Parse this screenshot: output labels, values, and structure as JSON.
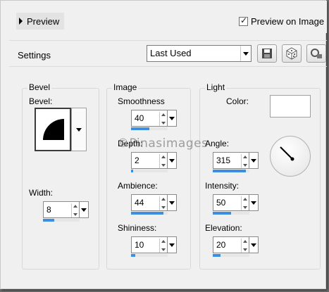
{
  "preview": {
    "toggle_label": "Preview",
    "checkbox_label": "Preview on Image",
    "checked": true
  },
  "settings": {
    "label": "Settings",
    "preset_value": "Last Used",
    "icons": [
      "save-icon",
      "dice-icon",
      "reset-icon"
    ]
  },
  "bevel_group": {
    "title": "Bevel",
    "bevel_label": "Bevel:",
    "width_label": "Width:",
    "width": {
      "value": "8",
      "level": 0.3
    }
  },
  "image_group": {
    "title": "Image",
    "smoothness": {
      "label": "Smoothness",
      "value": "40",
      "level": 0.5
    },
    "depth": {
      "label": "Depth:",
      "value": "2",
      "level": 0.05
    },
    "ambience": {
      "label": "Ambience:",
      "value": "44",
      "level": 0.88
    },
    "shininess": {
      "label": "Shininess:",
      "value": "10",
      "level": 0.12
    }
  },
  "light_group": {
    "title": "Light",
    "color_label": "Color:",
    "color": "#ffffff",
    "angle": {
      "label": "Angle:",
      "value": "315",
      "level": 0.9
    },
    "intensity": {
      "label": "Intensity:",
      "value": "50",
      "level": 0.5
    },
    "elevation": {
      "label": "Elevation:",
      "value": "20",
      "level": 0.22
    }
  },
  "watermark": "©Pinasimages"
}
